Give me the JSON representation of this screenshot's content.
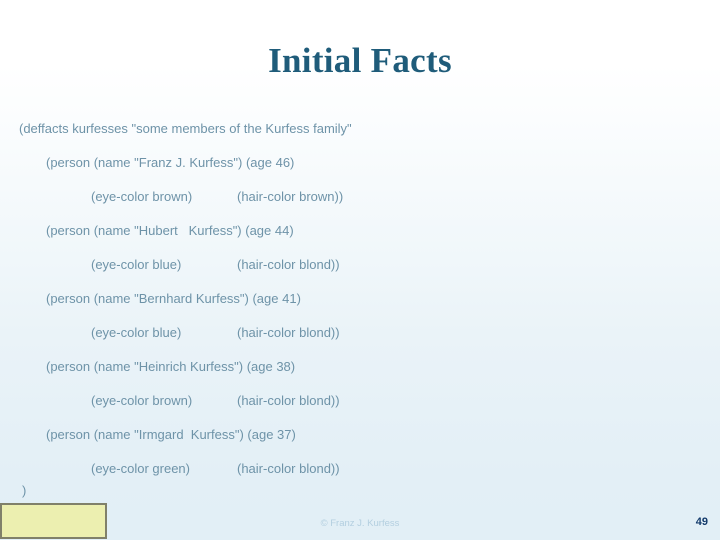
{
  "slide": {
    "title": "Initial Facts",
    "page_number": "49",
    "copyright": "© Franz J. Kurfess",
    "colors": {
      "title": "#1F5C7A",
      "body_text": "#6E93A8",
      "page_number": "#123A6B",
      "copyright": "#B3CFE0",
      "background_top": "#FFFFFF",
      "background_bottom": "#E2EFF6",
      "placeholder_fill": "#ECEFB0",
      "placeholder_border": "#80806A"
    }
  },
  "fact_body": {
    "lines": [
      {
        "indent": 0,
        "main": "(deffacts kurfesses \"some members of the Kurfess family\"",
        "second": ""
      },
      {
        "indent": 1,
        "main": "(person (name \"Franz J. Kurfess\") (age 46)",
        "second": ""
      },
      {
        "indent": 2,
        "main": "(eye-color brown)",
        "second": "(hair-color brown))"
      },
      {
        "indent": 1,
        "main": "(person (name \"Hubert   Kurfess\") (age 44)",
        "second": ""
      },
      {
        "indent": 2,
        "main": "(eye-color blue)",
        "second": "(hair-color blond))"
      },
      {
        "indent": 1,
        "main": "(person (name \"Bernhard Kurfess\") (age 41)",
        "second": ""
      },
      {
        "indent": 2,
        "main": "(eye-color blue)",
        "second": "(hair-color blond))"
      },
      {
        "indent": 1,
        "main": "(person (name \"Heinrich Kurfess\") (age 38)",
        "second": ""
      },
      {
        "indent": 2,
        "main": "(eye-color brown)",
        "second": "(hair-color blond))"
      },
      {
        "indent": 1,
        "main": "(person (name \"Irmgard  Kurfess\") (age 37)",
        "second": ""
      },
      {
        "indent": 2,
        "main": "(eye-color green)",
        "second": "(hair-color blond))"
      }
    ],
    "closing_paren": ")"
  }
}
